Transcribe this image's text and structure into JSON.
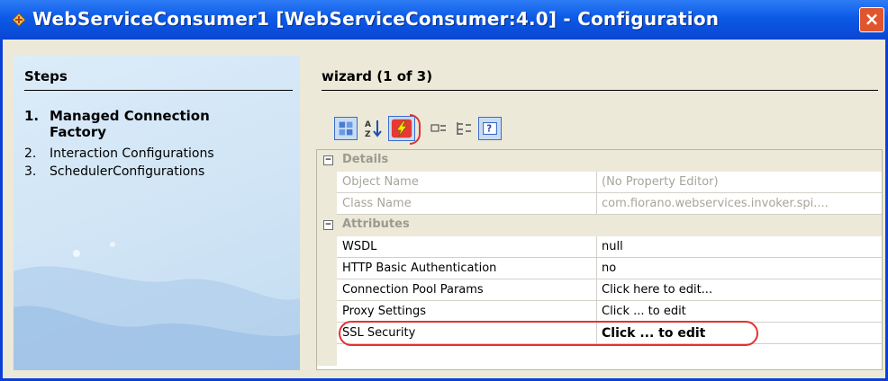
{
  "window": {
    "title": "WebServiceConsumer1 [WebServiceConsumer:4.0] - Configuration",
    "close_glyph": "×"
  },
  "steps": {
    "title": "Steps",
    "items": [
      {
        "num": "1.",
        "label": "Managed Connection Factory",
        "active": true
      },
      {
        "num": "2.",
        "label": "Interaction Configurations",
        "active": false
      },
      {
        "num": "3.",
        "label": "SchedulerConfigurations",
        "active": false
      }
    ]
  },
  "wizard": {
    "title": "wizard (1 of 3)"
  },
  "toolbar": {
    "icons": [
      "categorized-icon",
      "sort-alphabetical-icon",
      "events-lightning-icon",
      "expand-icon",
      "collapse-icon",
      "help-icon"
    ]
  },
  "property_grid": {
    "categories": [
      {
        "label": "Details",
        "toggle": "−",
        "rows": [
          {
            "name": "Object Name",
            "value": "(No Property Editor)"
          },
          {
            "name": "Class Name",
            "value": "com.fiorano.webservices.invoker.spi...."
          }
        ]
      },
      {
        "label": "Attributes",
        "toggle": "−",
        "rows": [
          {
            "name": "WSDL",
            "value": "null"
          },
          {
            "name": "HTTP Basic Authentication",
            "value": "no"
          },
          {
            "name": "Connection Pool Params",
            "value": "Click here to edit..."
          },
          {
            "name": "Proxy Settings",
            "value": "Click ... to edit"
          },
          {
            "name": "SSL Security",
            "value": "Click ... to edit"
          }
        ]
      }
    ]
  },
  "colors": {
    "titlebar": "#0b5ae6",
    "highlight": "#e23232",
    "steps_panel": "#cfe4f5"
  }
}
